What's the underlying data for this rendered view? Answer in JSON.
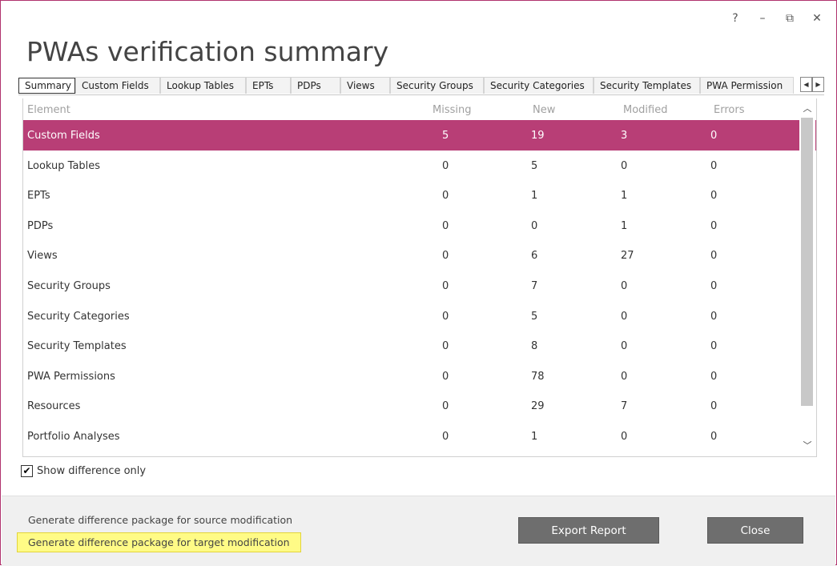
{
  "window": {
    "title": "PWAs verification summary",
    "controls": {
      "help": "?",
      "minimize": "–",
      "restore": "⧉",
      "close": "✕"
    }
  },
  "tabs": [
    "Summary",
    "Custom Fields",
    "Lookup Tables",
    "EPTs",
    "PDPs",
    "Views",
    "Security Groups",
    "Security Categories",
    "Security Templates",
    "PWA Permission"
  ],
  "active_tab": "Summary",
  "grid": {
    "headers": [
      "Element",
      "Missing",
      "New",
      "Modified",
      "Errors"
    ],
    "rows": [
      [
        "Custom Fields",
        "5",
        "19",
        "3",
        "0"
      ],
      [
        "Lookup Tables",
        "0",
        "5",
        "0",
        "0"
      ],
      [
        "EPTs",
        "0",
        "1",
        "1",
        "0"
      ],
      [
        "PDPs",
        "0",
        "0",
        "1",
        "0"
      ],
      [
        "Views",
        "0",
        "6",
        "27",
        "0"
      ],
      [
        "Security Groups",
        "0",
        "7",
        "0",
        "0"
      ],
      [
        "Security Categories",
        "0",
        "5",
        "0",
        "0"
      ],
      [
        "Security Templates",
        "0",
        "8",
        "0",
        "0"
      ],
      [
        "PWA Permissions",
        "0",
        "78",
        "0",
        "0"
      ],
      [
        "Resources",
        "0",
        "29",
        "7",
        "0"
      ],
      [
        "Portfolio Analyses",
        "0",
        "1",
        "0",
        "0"
      ]
    ],
    "selected_row": 0
  },
  "show_difference_only": {
    "label": "Show difference only",
    "checked": true
  },
  "footer": {
    "link_source": "Generate difference package for source modification",
    "link_target": "Generate difference package for target modification",
    "export_button": "Export Report",
    "close_button": "Close"
  },
  "colors": {
    "accent": "#b83e76",
    "highlight": "#fffb86",
    "button": "#6e6e6e"
  }
}
